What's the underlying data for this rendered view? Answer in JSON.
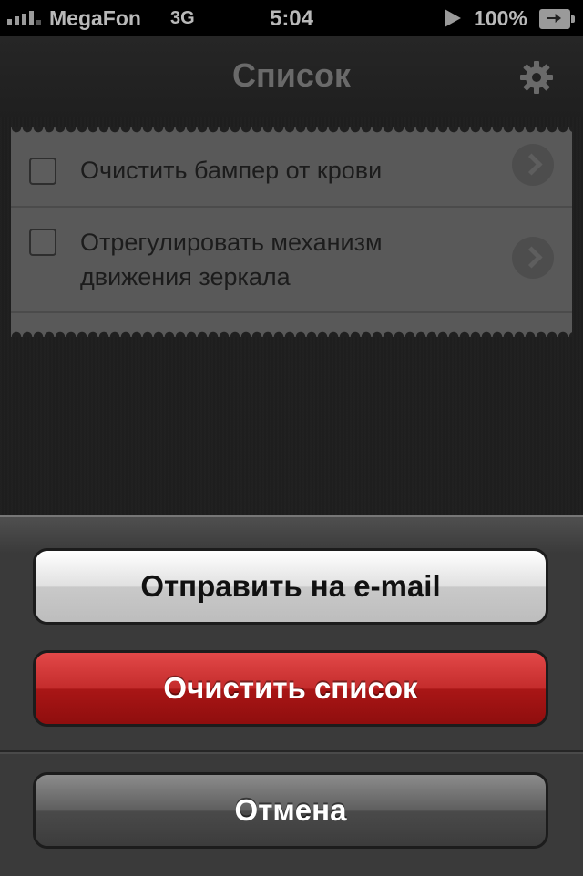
{
  "status_bar": {
    "carrier": "MegaFon",
    "network": "3G",
    "time": "5:04",
    "battery": "100%"
  },
  "nav": {
    "title": "Список",
    "settings_icon": "gear-icon"
  },
  "list": {
    "items": [
      {
        "text": "Очистить бампер от крови",
        "checked": false
      },
      {
        "text": "Отрегулировать механизм движения зеркала",
        "checked": false
      }
    ]
  },
  "action_sheet": {
    "email_label": "Отправить на e-mail",
    "clear_label": "Очистить список",
    "cancel_label": "Отмена"
  },
  "colors": {
    "destructive": "#c42c2c",
    "paper": "#595959"
  }
}
